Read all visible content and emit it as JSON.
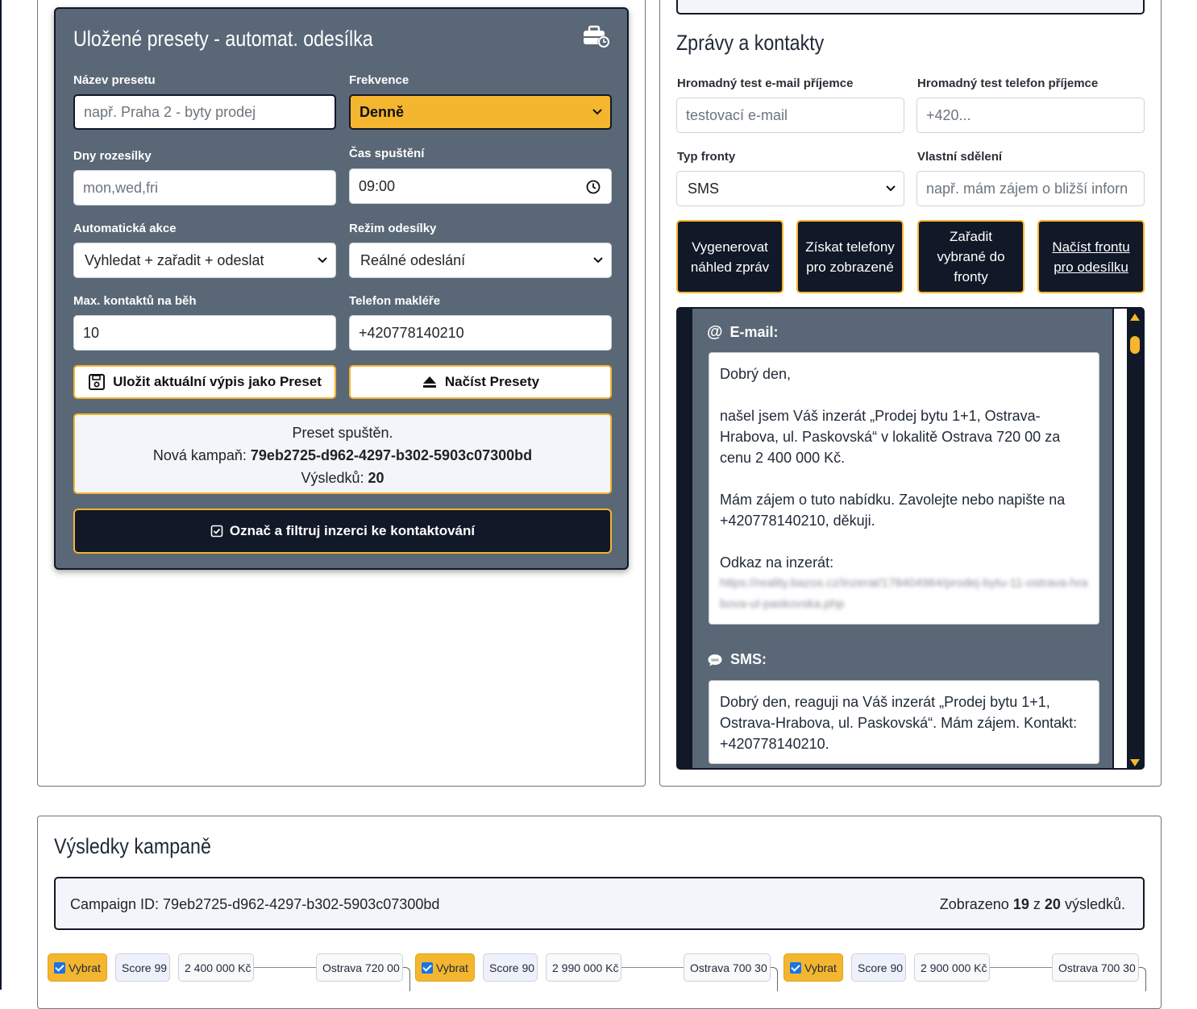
{
  "preset_panel": {
    "title": "Uložené presety - automat. odesílka",
    "preset_name_label": "Název presetu",
    "preset_name_placeholder": "např. Praha 2 - byty prodej",
    "frequency_label": "Frekvence",
    "frequency_value": "Denně",
    "days_label": "Dny rozesílky",
    "days_placeholder": "mon,wed,fri",
    "time_label": "Čas spuštění",
    "time_value": "09:00",
    "auto_action_label": "Automatická akce",
    "auto_action_value": "Vyhledat + zařadit + odeslat",
    "send_mode_label": "Režim odesílky",
    "send_mode_value": "Reálné odeslání",
    "max_contacts_label": "Max. kontaktů na běh",
    "max_contacts_value": "10",
    "broker_phone_label": "Telefon makléře",
    "broker_phone_value": "+420778140210",
    "save_preset_label": "Uložit aktuální výpis jako Preset",
    "load_presets_label": "Načíst Presety",
    "status_line1": "Preset spuštěn.",
    "status_campaign_prefix": "Nová kampaň:",
    "status_campaign_id": "79eb2725-d962-4297-b302-5903c07300bd",
    "status_results_prefix": "Výsledků:",
    "status_results_count": "20",
    "filter_button_label": "Označ a filtruj inzerci ke kontaktování"
  },
  "messages_panel": {
    "title": "Zprávy a kontakty",
    "test_email_label": "Hromadný test e-mail příjemce",
    "test_email_placeholder": "testovací e-mail",
    "test_phone_label": "Hromadný test telefon příjemce",
    "test_phone_placeholder": "+420...",
    "queue_type_label": "Typ fronty",
    "queue_type_value": "SMS",
    "custom_message_label": "Vlastní sdělení",
    "custom_message_placeholder": "např. mám zájem o bližší inforn",
    "btn_generate": "Vygenerovat náhled zpráv",
    "btn_get_phones": "Získat telefony pro zobrazené",
    "btn_enqueue": "Zařadit vybrané do fronty",
    "btn_load_queue": "Načíst frontu pro odesílku",
    "email_heading": "E-mail:",
    "email_body": [
      "Dobrý den,",
      "",
      "našel jsem Váš inzerát „Prodej bytu 1+1, Ostrava-Hrabova, ul. Paskovská“ v lokalitě Ostrava 720 00 za cenu 2 400 000 Kč.",
      "",
      "Mám zájem o tuto nabídku. Zavolejte nebo napište na +420778140210, děkuji.",
      "",
      "Odkaz na inzerát:"
    ],
    "email_link": "https://reality.bazos.cz/inzerat/178404964/prodej-bytu-11-ostrava-hrabova-ul-paskovska.php",
    "sms_heading": "SMS:",
    "sms_body": "Dobrý den, reaguji na Váš inzerát „Prodej bytu 1+1, Ostrava-Hrabova, ul. Paskovská“. Mám zájem. Kontakt: +420778140210."
  },
  "results": {
    "title": "Výsledky kampaně",
    "campaign_label": "Campaign ID: 79eb2725-d962-4297-b302-5903c07300bd",
    "shown_prefix": "Zobrazeno",
    "shown_count": "19",
    "shown_mid": "z",
    "shown_total": "20",
    "shown_suffix": "výsledků.",
    "items": [
      {
        "select": "Vybrat",
        "score": "Score 99",
        "price": "2 400 000 Kč",
        "location": "Ostrava 720 00"
      },
      {
        "select": "Vybrat",
        "score": "Score 90",
        "price": "2 990 000 Kč",
        "location": "Ostrava 700 30"
      },
      {
        "select": "Vybrat",
        "score": "Score 90",
        "price": "2 900 000 Kč",
        "location": "Ostrava 700 30"
      }
    ]
  },
  "colors": {
    "accent": "#f4b52f",
    "dark": "#111827",
    "panel": "#5a6776"
  }
}
